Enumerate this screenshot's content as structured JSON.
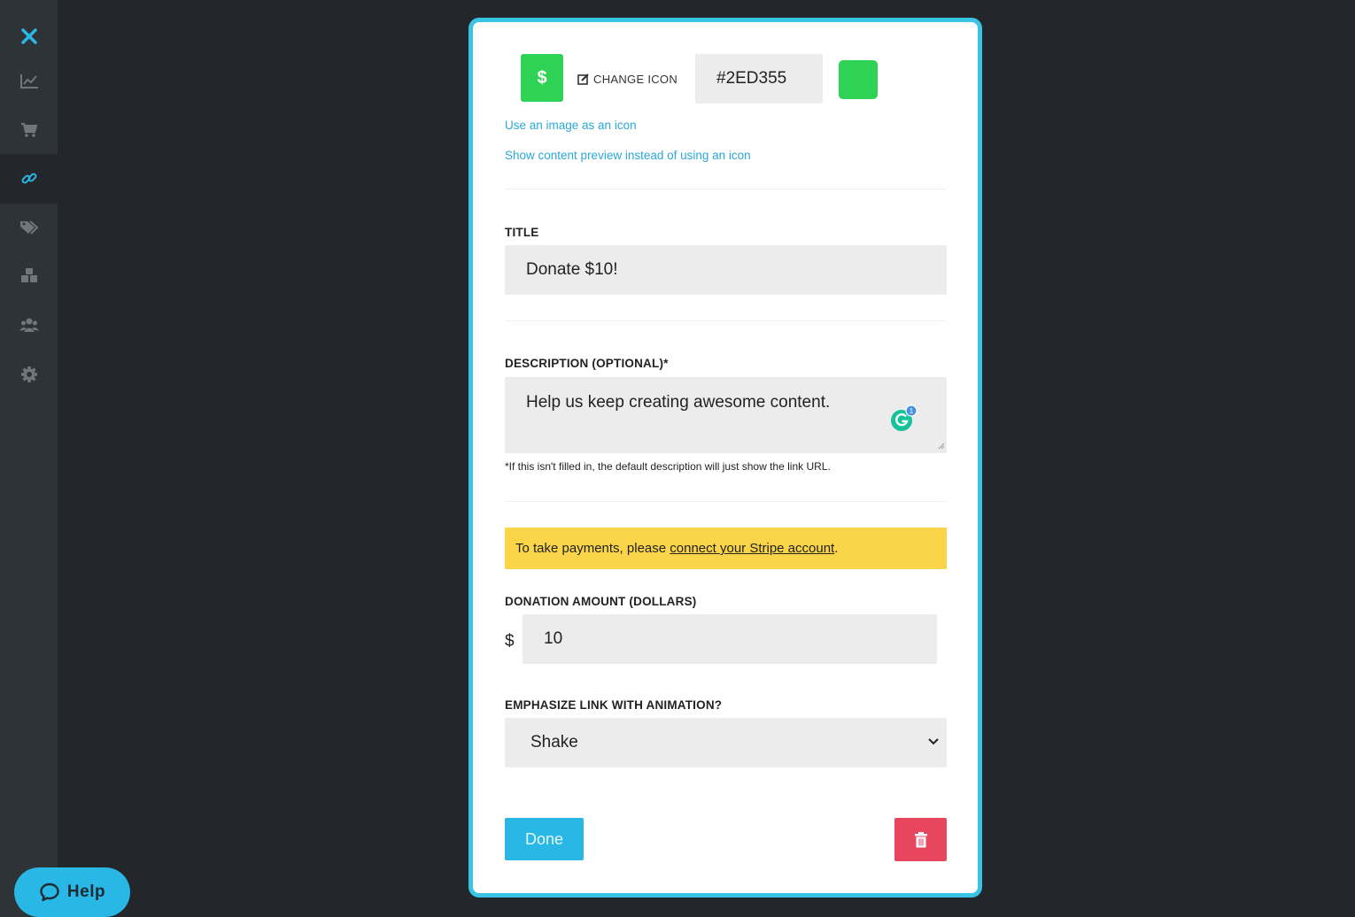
{
  "sidebar": {
    "items": [
      {
        "icon": "close-icon",
        "active": false
      },
      {
        "icon": "chart-line-icon",
        "active": false
      },
      {
        "icon": "cart-icon",
        "active": false
      },
      {
        "icon": "link-icon",
        "active": true
      },
      {
        "icon": "tags-icon",
        "active": false
      },
      {
        "icon": "blocks-icon",
        "active": false
      },
      {
        "icon": "users-icon",
        "active": false
      },
      {
        "icon": "gear-icon",
        "active": false
      }
    ],
    "accent": "#29b7e6"
  },
  "help": {
    "label": "Help",
    "icon": "chat-bubble-icon"
  },
  "editor": {
    "icon_glyph": "$",
    "change_icon_label": "CHANGE ICON",
    "color_hex": "#2ED355",
    "swatch_color": "#2ED355",
    "image_icon_link": "Use an image as an icon",
    "preview_link": "Show content preview instead of using an icon",
    "title_label": "TITLE",
    "title_value": "Donate $10!",
    "description_label": "DESCRIPTION (OPTIONAL)*",
    "description_value": "Help us keep creating awesome content.",
    "description_hint": "*If this isn't filled in, the default description will just show the link URL.",
    "notice_prefix": "To take payments, please ",
    "notice_link": "connect your Stripe account",
    "notice_suffix": ".",
    "amount_label": "DONATION AMOUNT (DOLLARS)",
    "currency_symbol": "$",
    "amount_value": "10",
    "animation_label": "EMPHASIZE LINK WITH ANIMATION?",
    "animation_value": "Shake",
    "done_label": "Done",
    "delete_icon": "trash-icon",
    "grammarly_badge": "1"
  }
}
